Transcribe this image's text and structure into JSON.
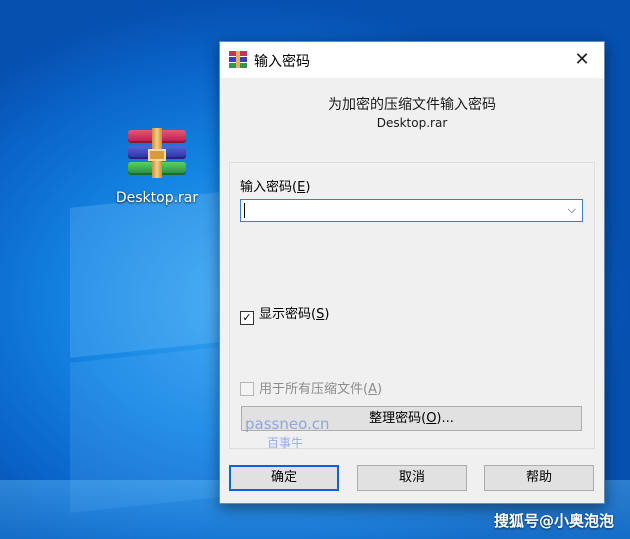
{
  "desktop": {
    "icon_label": "Desktop.rar",
    "icon_name": "winrar-archive-icon"
  },
  "dialog": {
    "title": "输入密码",
    "close_glyph": "✕",
    "heading": "为加密的压缩文件输入密码",
    "archive_name": "Desktop.rar",
    "password_label": "输入密码",
    "password_mnemonic": "E",
    "password_value": "",
    "dropdown_glyph": "⌵",
    "show_password": {
      "label": "显示密码",
      "mnemonic": "S",
      "checked": true,
      "check_glyph": "✓"
    },
    "use_for_all": {
      "label": "用于所有压缩文件",
      "mnemonic": "A",
      "checked": false,
      "enabled": false
    },
    "organize_button": {
      "label": "整理密码",
      "mnemonic": "O",
      "suffix": "..."
    },
    "buttons": {
      "ok": "确定",
      "cancel": "取消",
      "help": "帮助"
    }
  },
  "watermarks": {
    "site": "passneo.cn",
    "site_sub": "百事牛",
    "corner": "搜狐号@小奥泡泡"
  },
  "colors": {
    "accent": "#0a66cc",
    "desktop_blue": "#1485e3"
  }
}
